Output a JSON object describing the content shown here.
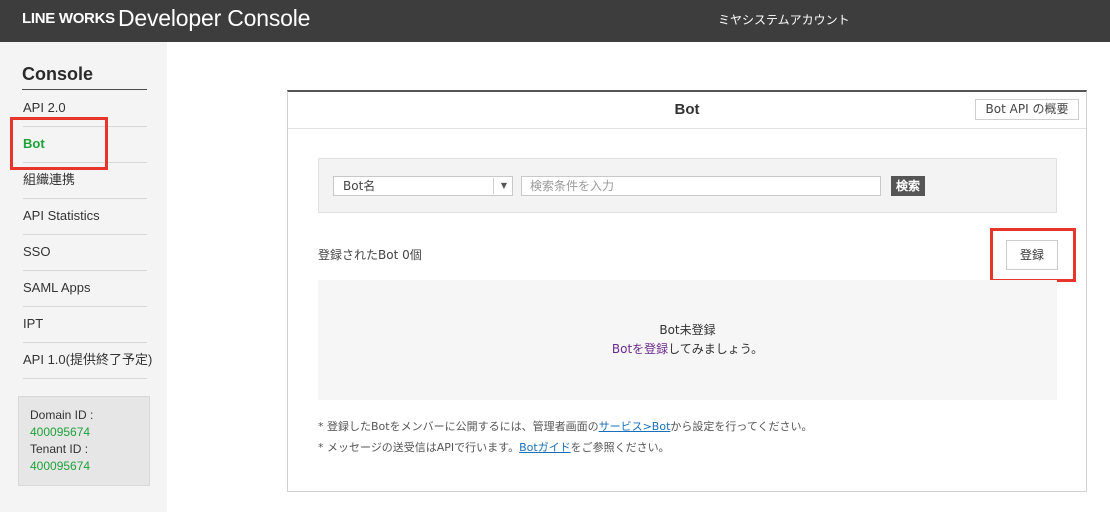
{
  "header": {
    "brand": "LINE WORKS",
    "product": "Developer Console",
    "account": "ミヤシステムアカウント"
  },
  "sidebar": {
    "title": "Console",
    "items": [
      {
        "label": "API 2.0"
      },
      {
        "label": "Bot",
        "active": true
      },
      {
        "label": "組織連携"
      },
      {
        "label": "API Statistics"
      },
      {
        "label": "SSO"
      },
      {
        "label": "SAML Apps"
      },
      {
        "label": "IPT"
      },
      {
        "label": "API 1.0(提供終了予定)"
      }
    ],
    "domain_label": "Domain ID :",
    "domain_id": "400095674",
    "tenant_label": "Tenant ID :",
    "tenant_id": "400095674"
  },
  "panel": {
    "title": "Bot",
    "overview_button": "Bot API の概要",
    "search": {
      "select_value": "Bot名",
      "placeholder": "検索条件を入力",
      "button": "検索"
    },
    "count_text": "登録されたBot 0個",
    "register_button": "登録",
    "empty": {
      "title": "Bot未登録",
      "link": "Botを登録",
      "suffix": "してみましょう。"
    },
    "notes": [
      {
        "prefix": "* 登録したBotをメンバーに公開するには、管理者画面の",
        "link": "サービス>Bot",
        "suffix": "から設定を行ってください。"
      },
      {
        "prefix": "* メッセージの送受信はAPIで行います。",
        "link": "Botガイド",
        "suffix": "をご参照ください。"
      }
    ]
  },
  "colors": {
    "header_bg": "#3d3d3d",
    "active_green": "#1fa13a",
    "highlight_red": "#e8352a",
    "link_blue": "#1a6fb8",
    "link_purple": "#6a2b8f"
  }
}
